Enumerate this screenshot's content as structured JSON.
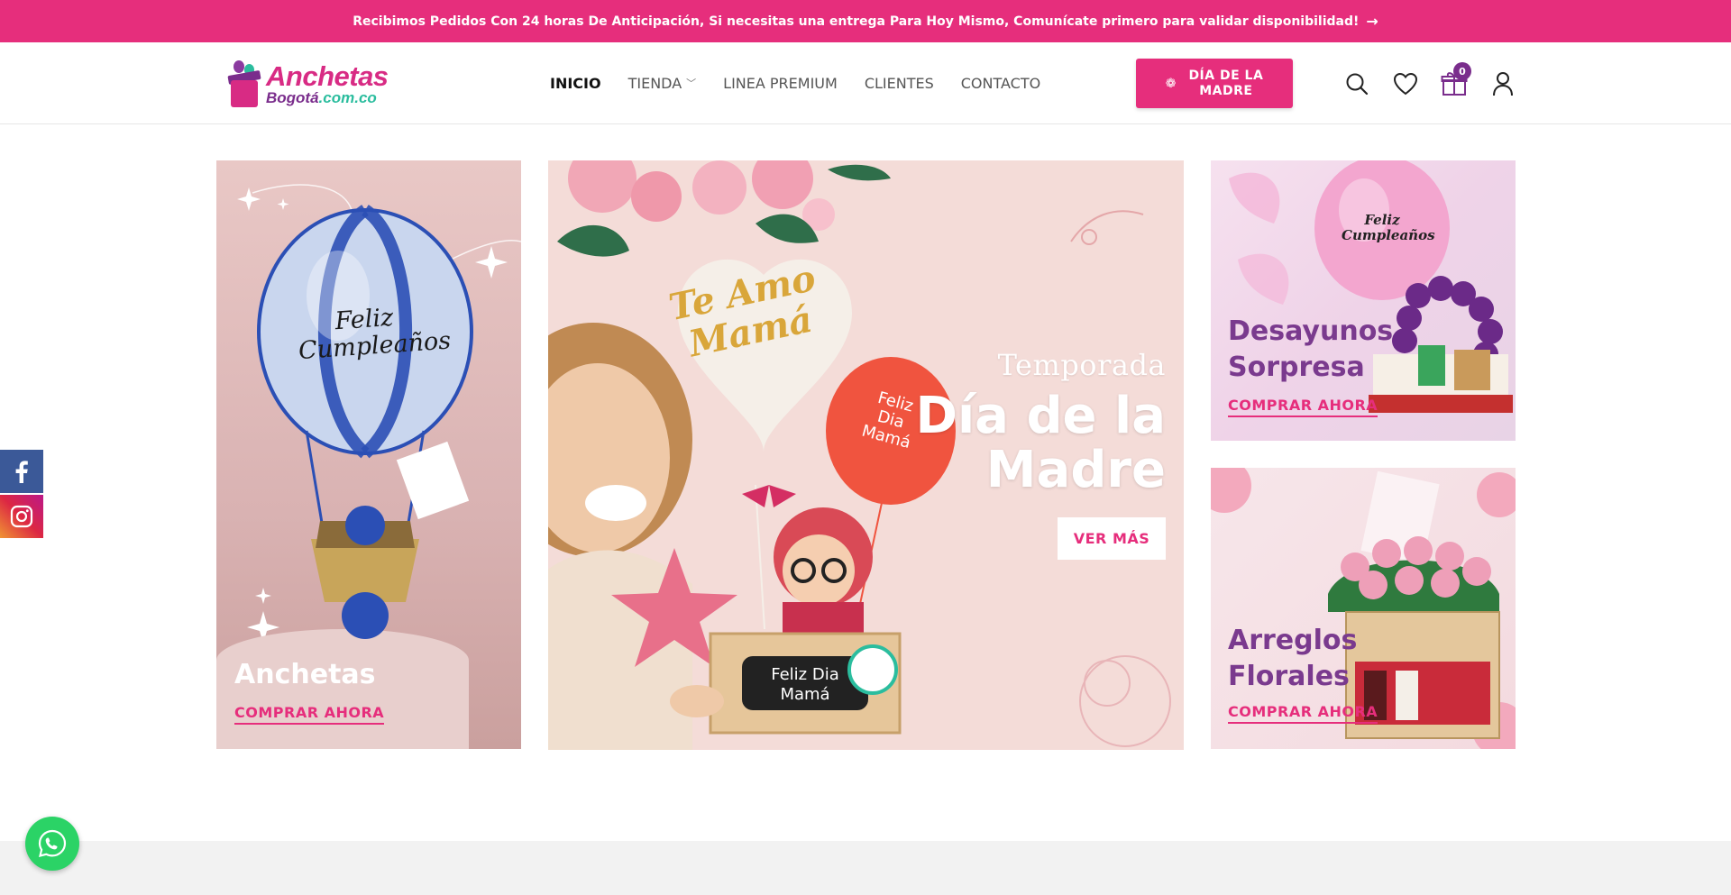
{
  "announcement": {
    "text": "Recibimos Pedidos Con 24 horas De Anticipación, Si necesitas una entrega Para Hoy Mismo, Comunícate primero para validar disponibilidad!",
    "arrow": "→"
  },
  "logo": {
    "line1": "Anchetas",
    "line2": "Bogotá",
    "tld": ".com.co"
  },
  "nav": {
    "items": [
      {
        "label": "INICIO",
        "active": true
      },
      {
        "label": "TIENDA",
        "has_dropdown": true
      },
      {
        "label": "LINEA PREMIUM"
      },
      {
        "label": "CLIENTES"
      },
      {
        "label": "CONTACTO"
      }
    ]
  },
  "cta": {
    "label_line1": "DÍA DE LA",
    "label_line2": "MADRE",
    "icon": "flower-icon"
  },
  "header_icons": {
    "search": "search-icon",
    "wishlist": "heart-icon",
    "cart": "gift-icon",
    "cart_count": "0",
    "account": "user-icon"
  },
  "social": {
    "facebook": "facebook-icon",
    "instagram": "instagram-icon"
  },
  "banners": {
    "left": {
      "title": "Anchetas",
      "link": "COMPRAR AHORA",
      "balloon_text_1": "Feliz",
      "balloon_text_2": "Cumpleaños"
    },
    "center": {
      "subtitle": "Temporada",
      "title_line1": "Día de la",
      "title_line2": "Madre",
      "button": "VER MÁS",
      "heart_text_1": "Te Amo",
      "heart_text_2": "Mamá",
      "balloon_text_1": "Feliz",
      "balloon_text_2": "Dia",
      "balloon_text_3": "Mamá",
      "box_text_1": "Feliz Dia",
      "box_text_2": "Mamá"
    },
    "top_right": {
      "title_line1": "Desayunos",
      "title_line2": "Sorpresa",
      "link": "COMPRAR AHORA",
      "balloon_text_1": "Feliz",
      "balloon_text_2": "Cumpleaños"
    },
    "bottom_right": {
      "title_line1": "Arreglos",
      "title_line2": "Florales",
      "link": "COMPRAR AHORA"
    }
  },
  "colors": {
    "brand_pink": "#e62e7c",
    "brand_purple": "#7a2d8c",
    "whatsapp_green": "#2bd366"
  },
  "whatsapp": {
    "icon": "whatsapp-icon"
  }
}
